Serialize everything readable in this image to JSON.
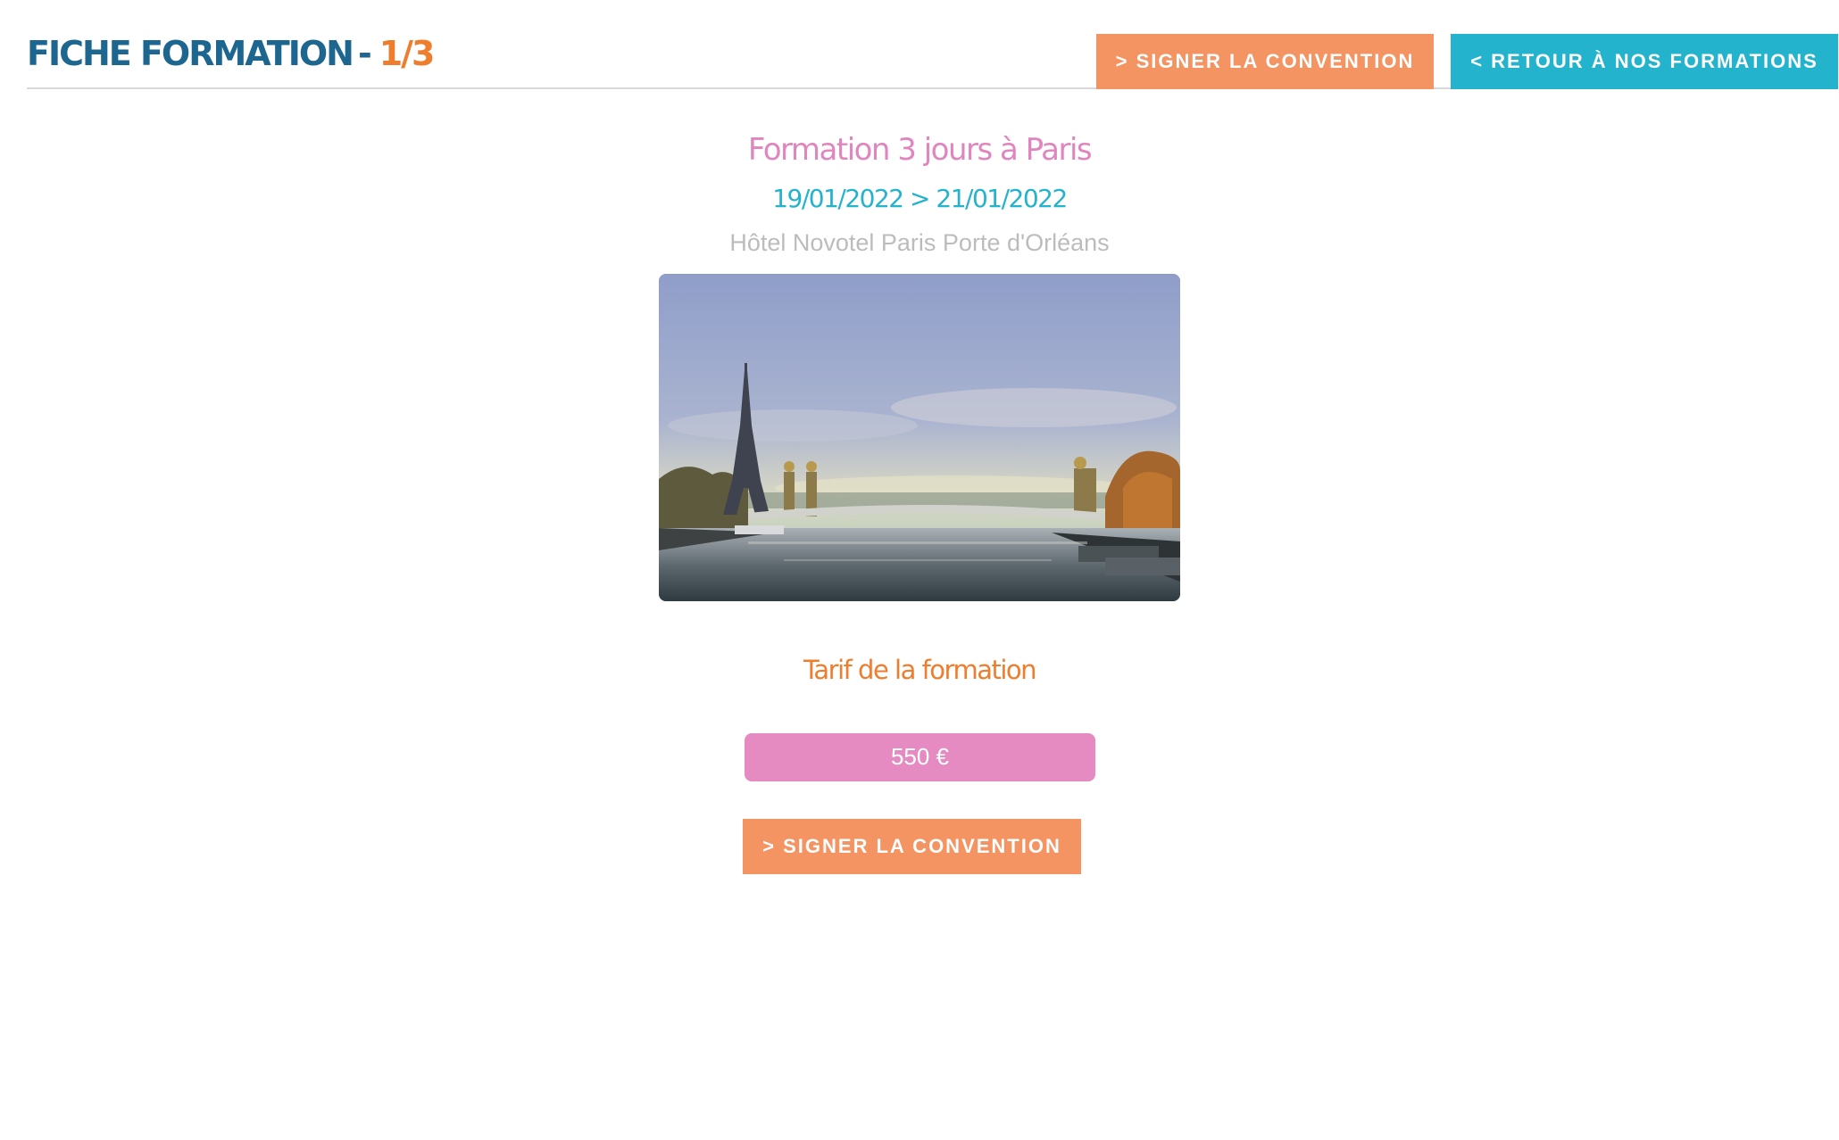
{
  "header": {
    "title": "FICHE FORMATION",
    "separator": "-",
    "counter": "1/3",
    "sign_button": "> SIGNER LA CONVENTION",
    "back_button": "< RETOUR À NOS FORMATIONS"
  },
  "formation": {
    "title": "Formation 3 jours à Paris",
    "dates": "19/01/2022 > 21/01/2022",
    "venue": "Hôtel Novotel Paris Porte d'Orléans"
  },
  "pricing": {
    "heading": "Tarif de la formation",
    "price": "550 €",
    "sign_button": "> SIGNER LA CONVENTION"
  },
  "colors": {
    "title_blue": "#1d6690",
    "accent_orange": "#ee7d2e",
    "button_orange": "#f39462",
    "button_teal": "#23b3cc",
    "pink": "#e085bd",
    "price_pill": "#e58bc2",
    "venue_gray": "#bcbcbc"
  }
}
